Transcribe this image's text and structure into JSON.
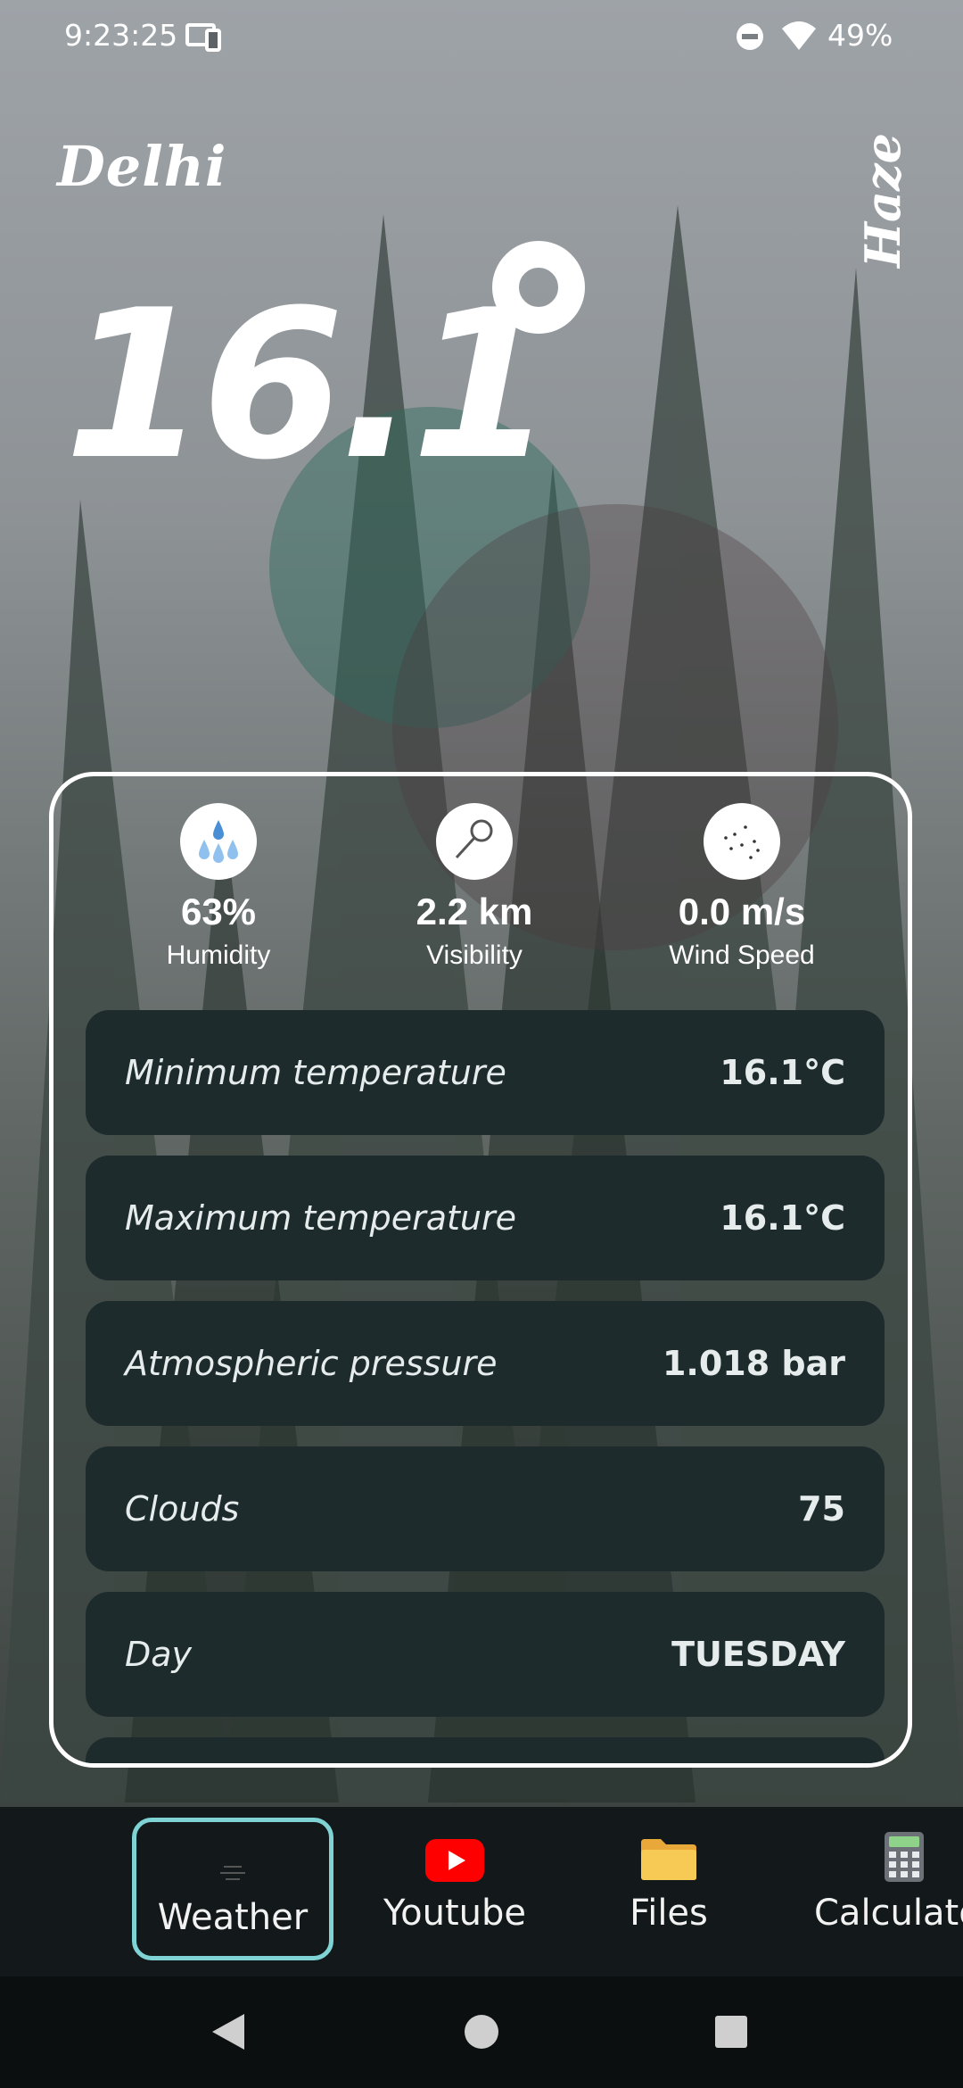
{
  "status_bar": {
    "time": "9:23:25",
    "battery": "49%"
  },
  "weather": {
    "city": "Delhi",
    "temperature": "16.1",
    "condition": "Haze"
  },
  "stats": [
    {
      "value": "63%",
      "label": "Humidity",
      "icon": "droplets-icon"
    },
    {
      "value": "2.2 km",
      "label": "Visibility",
      "icon": "magnifier-icon"
    },
    {
      "value": "0.0 m/s",
      "label": "Wind Speed",
      "icon": "wind-dots-icon"
    }
  ],
  "details": [
    {
      "label": "Minimum temperature",
      "value": "16.1°C"
    },
    {
      "label": "Maximum temperature",
      "value": "16.1°C"
    },
    {
      "label": "Atmospheric pressure",
      "value": "1.018 bar"
    },
    {
      "label": "Clouds",
      "value": "75"
    },
    {
      "label": "Day",
      "value": "TUESDAY"
    }
  ],
  "tabs": [
    {
      "label": "Weather",
      "icon": "weather-icon",
      "active": true
    },
    {
      "label": "Youtube",
      "icon": "youtube-icon"
    },
    {
      "label": "Files",
      "icon": "folder-icon"
    },
    {
      "label": "Calculator",
      "icon": "calculator-icon"
    }
  ],
  "colors": {
    "accent": "#7fd3d4",
    "row_bg": "#1d2b2c",
    "tabbar_bg": "#13191a"
  }
}
